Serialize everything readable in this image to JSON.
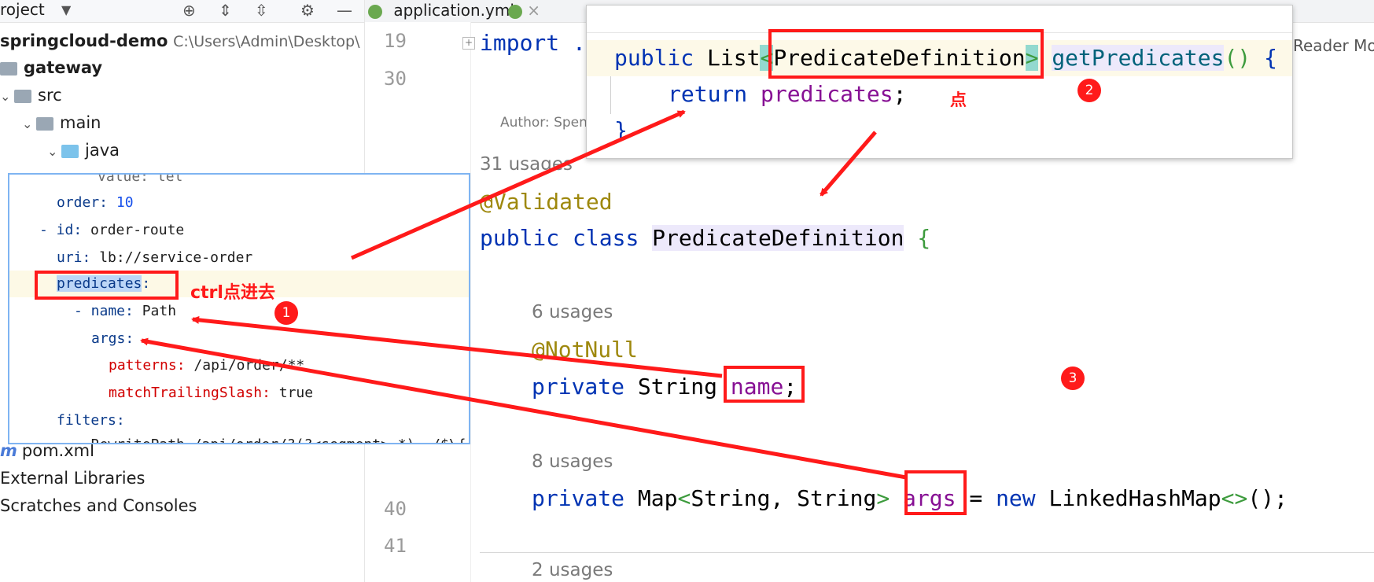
{
  "project_pane": {
    "title": "roject",
    "root": {
      "name": "springcloud-demo",
      "path": "C:\\Users\\Admin\\Desktop\\"
    },
    "tree": [
      "gateway",
      "src",
      "main",
      "java",
      "pom.xml",
      "External Libraries",
      "Scratches and Consoles"
    ]
  },
  "tabs": {
    "active": "application.yml",
    "close": "×"
  },
  "editor": {
    "line_numbers": {
      "l1": "19",
      "l2": "30",
      "l3": "40",
      "l4": "41"
    },
    "import_line": "import .",
    "author_prefix": "Author:",
    "author_name": "Spen",
    "reader_mode": "Reader Mo",
    "usages": {
      "class": "31 usages",
      "name": "6 usages",
      "args": "8 usages",
      "next": "2 usages"
    },
    "validated": "@Validated",
    "class_decl": {
      "public": "public",
      "class": "class",
      "name": "PredicateDefinition",
      "brace": "{"
    },
    "notnull": "@NotNull",
    "name_field": {
      "private": "private",
      "type": "String",
      "name": "name",
      "semi": ";"
    },
    "args_field": {
      "private": "private",
      "type_prefix": "Map",
      "lt": "<",
      "generics": "String, String",
      "gt": ">",
      "name": "args",
      "eq": "=",
      "new": "new",
      "ctor": "LinkedHashMap",
      "diamond": "<>",
      "rest": "();"
    }
  },
  "definition_popup": {
    "l1_public": "public",
    "l1_list": "List",
    "l1_lt": "<",
    "l1_type": "PredicateDefinition",
    "l1_gt": ">",
    "l1_method": "getPredicates",
    "l1_parens": "()",
    "l1_brace": "{",
    "l2_return": "return",
    "l2_field": "predicates",
    "l2_semi": ";",
    "l3": "}"
  },
  "yaml_popup": {
    "value_line": "value: tel",
    "order_key": "order:",
    "order_val": "10",
    "id_key": "- id:",
    "id_val": "order-route",
    "uri_key": "uri:",
    "uri_val": "lb://service-order",
    "predicates_key": "predicates",
    "predicates_colon": ":",
    "name_key": "- name:",
    "name_val": "Path",
    "args_key": "args:",
    "patterns_key": "patterns:",
    "patterns_val": "/api/order/**",
    "match_key": "matchTrailingSlash:",
    "match_val": "true",
    "filters_key": "filters:",
    "cut_line": "- RewritePath=/api/order/?(?<segment>.*), /$\\{"
  },
  "annotations": {
    "ctrl_label": "ctrl点进去",
    "click_label": "点",
    "badge1": "1",
    "badge2": "2",
    "badge3": "3"
  },
  "colors": {
    "annotation_red": "#ff1a1a",
    "keyword": "#0033b3",
    "field": "#871094",
    "annotation": "#9e880d"
  }
}
